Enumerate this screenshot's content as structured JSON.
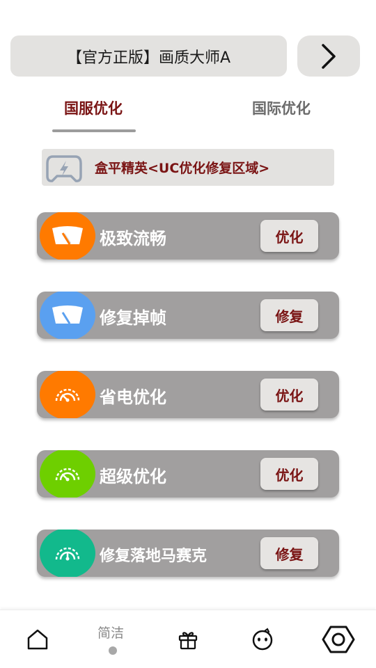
{
  "header": {
    "title": "【官方正版】画质大师A",
    "next_icon": "chevron-right-icon"
  },
  "tabs": [
    {
      "label": "国服优化",
      "active": true
    },
    {
      "label": "国际优化",
      "active": false
    }
  ],
  "notice": {
    "icon": "gamepad-icon",
    "text": "盒平精英<UC优化修复区域>"
  },
  "cards": [
    {
      "label": "极致流畅",
      "action": "优化",
      "color": "#ff7a00",
      "icon": "speedometer-icon"
    },
    {
      "label": "修复掉帧",
      "action": "修复",
      "color": "#5aa0f0",
      "icon": "speedometer-icon"
    },
    {
      "label": "省电优化",
      "action": "优化",
      "color": "#ff7a00",
      "icon": "gauge-icon"
    },
    {
      "label": "超级优化",
      "action": "优化",
      "color": "#6ecf00",
      "icon": "gauge-icon"
    },
    {
      "label": "修复落地马赛克",
      "action": "修复",
      "color": "#12b98c",
      "icon": "gauge-icon"
    }
  ],
  "nav": {
    "items": [
      {
        "name": "home-icon"
      },
      {
        "label": "简洁"
      },
      {
        "name": "gift-icon"
      },
      {
        "name": "face-icon"
      },
      {
        "name": "settings-icon"
      }
    ]
  }
}
